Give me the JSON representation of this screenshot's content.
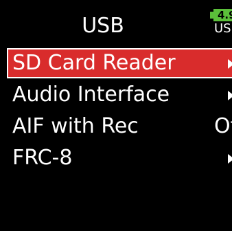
{
  "screen": {
    "title": "USB",
    "battery": {
      "level_text": "4.9",
      "source_text": "USB",
      "color": "#5bbf3a"
    }
  },
  "menu": {
    "items": [
      {
        "label": "SD Card Reader",
        "value": "",
        "has_arrow": true,
        "selected": true
      },
      {
        "label": "Audio Interface",
        "value": "",
        "has_arrow": true,
        "selected": false
      },
      {
        "label": "AIF with Rec",
        "value": "Off",
        "has_arrow": false,
        "selected": false
      },
      {
        "label": "FRC-8",
        "value": "",
        "has_arrow": true,
        "selected": false
      }
    ]
  },
  "colors": {
    "background": "#000000",
    "selection": "#d92c2c",
    "text": "#ffffff"
  }
}
